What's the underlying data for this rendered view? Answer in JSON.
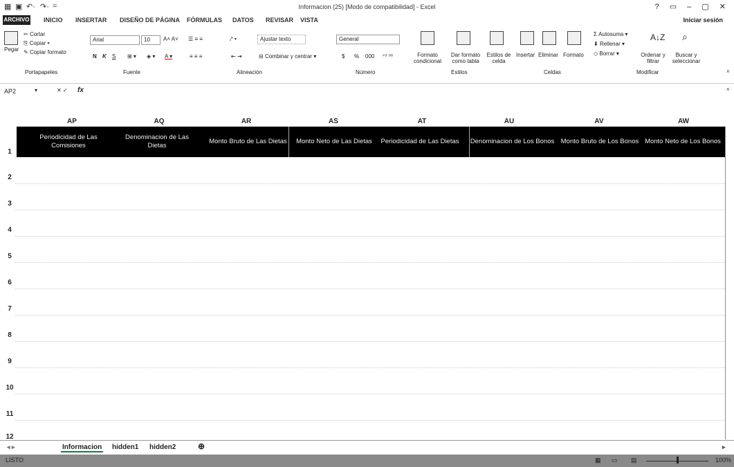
{
  "titlebar": {
    "title": "Informacion (25) [Modo de compatibilidad] - Excel",
    "help": "?",
    "controls": "▭ – ▢ ✕"
  },
  "tabs": {
    "file": "ARCHIVO",
    "items": [
      "INICIO",
      "INSERTAR",
      "DISEÑO DE PÁGINA",
      "FÓRMULAS",
      "DATOS",
      "REVISAR",
      "VISTA"
    ],
    "signin": "Iniciar sesión"
  },
  "ribbon": {
    "clipboard": {
      "paste": "Pegar",
      "cut": "Cortar",
      "copy": "Copiar",
      "format_painter": "Copiar formato",
      "group": "Portapapeles"
    },
    "font": {
      "name": "Arial",
      "size": "10",
      "bold": "N",
      "italic": "K",
      "underline": "S",
      "group": "Fuente"
    },
    "alignment": {
      "wrap": "Ajustar texto",
      "merge": "Combinar y centrar",
      "group": "Alineación"
    },
    "number": {
      "format": "General",
      "currency": "$",
      "percent": "%",
      "thousands": "000",
      "group": "Número"
    },
    "styles": {
      "conditional": "Formato condicional",
      "as_table": "Dar formato como tabla",
      "cell_styles": "Estilos de celda",
      "group": "Estilos"
    },
    "cells": {
      "insert": "Insertar",
      "delete": "Eliminar",
      "format": "Formato",
      "group": "Celdas"
    },
    "editing": {
      "autosum": "Autosuma",
      "fill": "Rellenar",
      "clear": "Borrar",
      "sort": "Ordenar y filtrar",
      "find": "Buscar y seleccionar",
      "group": "Modificar"
    }
  },
  "formula_bar": {
    "name_box": "AP2",
    "fx": "fx",
    "content": ""
  },
  "grid": {
    "columns": [
      {
        "letter": "AP",
        "header": "Periodicidad de Las Comisiones"
      },
      {
        "letter": "AQ",
        "header": "Denominacion de Las Dietas"
      },
      {
        "letter": "AR",
        "header": "Monto Bruto de Las Dietas"
      },
      {
        "letter": "AS",
        "header": "Monto Neto de Las Dietas"
      },
      {
        "letter": "AT",
        "header": "Periodicidad de Las Dietas"
      },
      {
        "letter": "AU",
        "header": "Denominacion de Los Bonos"
      },
      {
        "letter": "AV",
        "header": "Monto Bruto de Los Bonos"
      },
      {
        "letter": "AW",
        "header": "Monto Neto de Los Bonos"
      }
    ],
    "rows": [
      "1",
      "2",
      "3",
      "4",
      "5",
      "6",
      "7",
      "8",
      "9",
      "10",
      "11",
      "12"
    ]
  },
  "sheets": {
    "tabs": [
      "Informacion",
      "hidden1",
      "hidden2"
    ],
    "add": "⊕"
  },
  "status": {
    "ready": "LISTO",
    "zoom": "100%"
  }
}
